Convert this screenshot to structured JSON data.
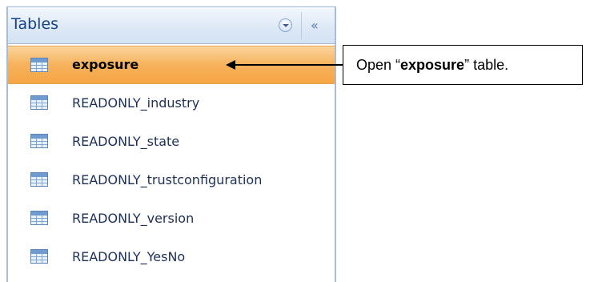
{
  "nav_pane": {
    "title": "Tables",
    "dropdown_icon": "chevron-down-icon",
    "collapse_label": "«",
    "items": [
      {
        "label": "exposure",
        "icon": "table-icon",
        "selected": true
      },
      {
        "label": "READONLY_industry",
        "icon": "table-icon",
        "selected": false
      },
      {
        "label": "READONLY_state",
        "icon": "table-icon",
        "selected": false
      },
      {
        "label": "READONLY_trustconfiguration",
        "icon": "table-icon",
        "selected": false
      },
      {
        "label": "READONLY_version",
        "icon": "table-icon",
        "selected": false
      },
      {
        "label": "READONLY_YesNo",
        "icon": "table-icon",
        "selected": false
      }
    ]
  },
  "callout": {
    "prefix": "Open “",
    "emphasis": "exposure",
    "suffix": "” table."
  },
  "colors": {
    "selected_item_bg": "#f7b25c",
    "header_text": "#15428b",
    "pane_border": "#a7bcd6"
  }
}
